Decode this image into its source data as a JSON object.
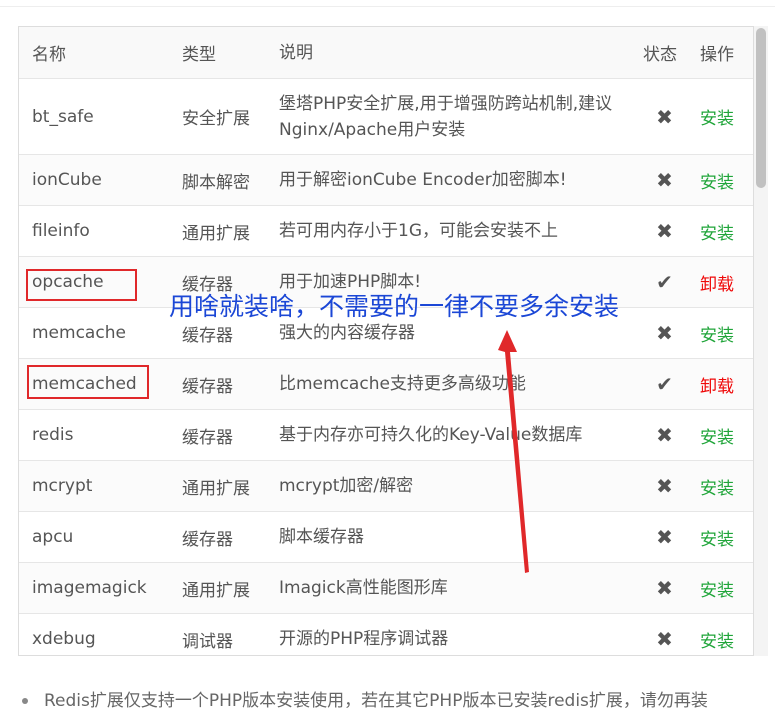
{
  "columns": {
    "name": "名称",
    "type": "类型",
    "desc": "说明",
    "status": "状态",
    "op": "操作"
  },
  "rows": [
    {
      "name": "bt_safe",
      "type": "安全扩展",
      "desc": "堡塔PHP安全扩展,用于增强防跨站机制,建议Nginx/Apache用户安装",
      "status": "✖",
      "op": "安装"
    },
    {
      "name": "ionCube",
      "type": "脚本解密",
      "desc": "用于解密ionCube Encoder加密脚本!",
      "status": "✖",
      "op": "安装"
    },
    {
      "name": "fileinfo",
      "type": "通用扩展",
      "desc": "若可用内存小于1G，可能会安装不上",
      "status": "✖",
      "op": "安装"
    },
    {
      "name": "opcache",
      "type": "缓存器",
      "desc": "用于加速PHP脚本!",
      "status": "✔",
      "op": "卸载"
    },
    {
      "name": "memcache",
      "type": "缓存器",
      "desc": "强大的内容缓存器",
      "status": "✖",
      "op": "安装"
    },
    {
      "name": "memcached",
      "type": "缓存器",
      "desc": "比memcache支持更多高级功能",
      "status": "✔",
      "op": "卸载"
    },
    {
      "name": "redis",
      "type": "缓存器",
      "desc": "基于内存亦可持久化的Key-Value数据库",
      "status": "✖",
      "op": "安装"
    },
    {
      "name": "mcrypt",
      "type": "通用扩展",
      "desc": "mcrypt加密/解密",
      "status": "✖",
      "op": "安装"
    },
    {
      "name": "apcu",
      "type": "缓存器",
      "desc": "脚本缓存器",
      "status": "✖",
      "op": "安装"
    },
    {
      "name": "imagemagick",
      "type": "通用扩展",
      "desc": "Imagick高性能图形库",
      "status": "✖",
      "op": "安装"
    },
    {
      "name": "xdebug",
      "type": "调试器",
      "desc": "开源的PHP程序调试器",
      "status": "✖",
      "op": "安装"
    }
  ],
  "annotation": {
    "text": "用啥就装啥，不需要的一律不要多余安装",
    "color": "#1b47d6",
    "box_color": "#e0282a"
  },
  "note": "Redis扩展仅支持一个PHP版本安装使用，若在其它PHP版本已安装redis扩展，请勿再装",
  "colors": {
    "install": "#20a53a",
    "uninstall": "#ef0808"
  }
}
